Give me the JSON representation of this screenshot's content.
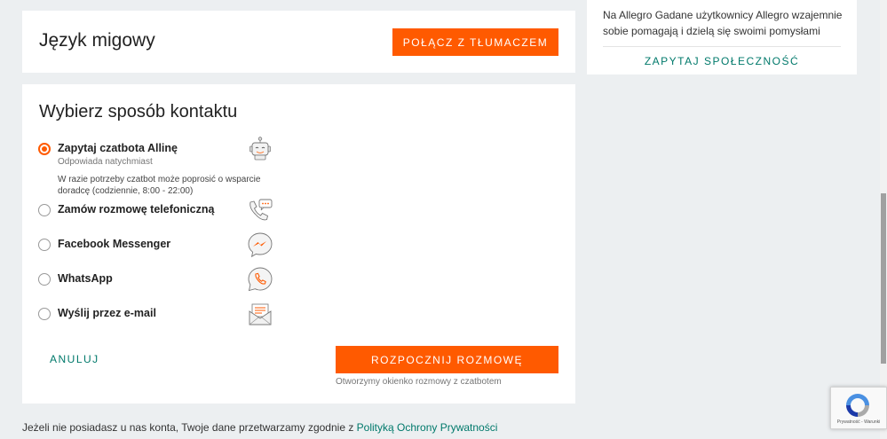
{
  "sign_language": {
    "title": "Język migowy",
    "button_label": "POŁĄCZ Z TŁUMACZEM"
  },
  "contact": {
    "title": "Wybierz sposób kontaktu",
    "options": [
      {
        "label": "Zapytaj czatbota Allinę",
        "sublabel": "Odpowiada natychmiast",
        "description": "W razie potrzeby czatbot może poprosić o wsparcie doradcę (codziennie, 8:00 - 22:00)",
        "icon": "robot-icon",
        "selected": true
      },
      {
        "label": "Zamów rozmowę telefoniczną",
        "icon": "phone-chat-icon",
        "selected": false
      },
      {
        "label": "Facebook Messenger",
        "icon": "messenger-icon",
        "selected": false
      },
      {
        "label": "WhatsApp",
        "icon": "whatsapp-icon",
        "selected": false
      },
      {
        "label": "Wyślij przez e-mail",
        "icon": "email-icon",
        "selected": false
      }
    ],
    "cancel_label": "ANULUJ",
    "start_label": "ROZPOCZNIJ ROZMOWĘ",
    "start_note": "Otworzymy okienko rozmowy z czatbotem"
  },
  "footer": {
    "text": "Jeżeli nie posiadasz u nas konta, Twoje dane przetwarzamy zgodnie z",
    "link": "Polityką Ochrony Prywatności"
  },
  "community": {
    "text": "Na Allegro Gadane użytkownicy Allegro wzajemnie sobie pomagają i dzielą się swoimi pomysłami",
    "button_label": "ZAPYTAJ SPOŁECZNOŚĆ"
  },
  "recaptcha": {
    "links": "Prywatność - Warunki"
  },
  "colors": {
    "accent": "#ff5a00",
    "link": "#00796b",
    "background": "#eceff1"
  }
}
